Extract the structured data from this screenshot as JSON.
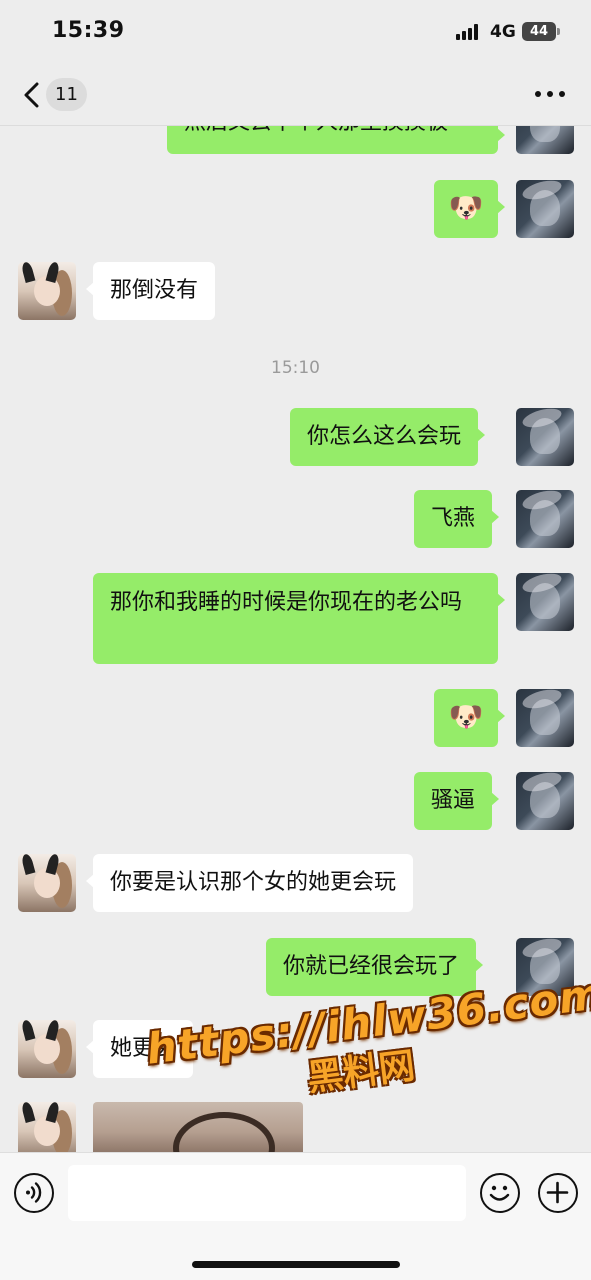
{
  "status_bar": {
    "time": "15:39",
    "network": "4G",
    "battery": "44"
  },
  "nav": {
    "unread_count": "11",
    "back_icon": "chevron-left-icon",
    "more_icon": "more-dots-icon"
  },
  "messages": [
    {
      "sender": "me",
      "text": "然后又去下个人那里摸摸板",
      "cut_off": true
    },
    {
      "sender": "me",
      "type": "sticker",
      "text": "🐶"
    },
    {
      "sender": "other",
      "text": "那倒没有"
    },
    {
      "type": "timestamp",
      "text": "15:10"
    },
    {
      "sender": "me",
      "text": "你怎么这么会玩"
    },
    {
      "sender": "me",
      "text": "飞燕"
    },
    {
      "sender": "me",
      "text": "那你和我睡的时候是你现在的老公吗"
    },
    {
      "sender": "me",
      "type": "sticker",
      "text": "🐶"
    },
    {
      "sender": "me",
      "text": "骚逼"
    },
    {
      "sender": "other",
      "text": "你要是认识那个女的她更会玩"
    },
    {
      "sender": "me",
      "text": "你就已经很会玩了"
    },
    {
      "sender": "other",
      "text": "她更会"
    },
    {
      "sender": "other",
      "type": "image",
      "text": ""
    }
  ],
  "watermark": {
    "url": "https://ihlw36.com",
    "subtitle": "黑料网"
  },
  "input_bar": {
    "placeholder": "",
    "voice_icon": "voice-icon",
    "emoji_icon": "smiley-icon",
    "plus_icon": "plus-circle-icon"
  },
  "colors": {
    "background": "#ededed",
    "bubble_me": "#95ec69",
    "bubble_other": "#ffffff",
    "watermark": "#f7a428"
  }
}
